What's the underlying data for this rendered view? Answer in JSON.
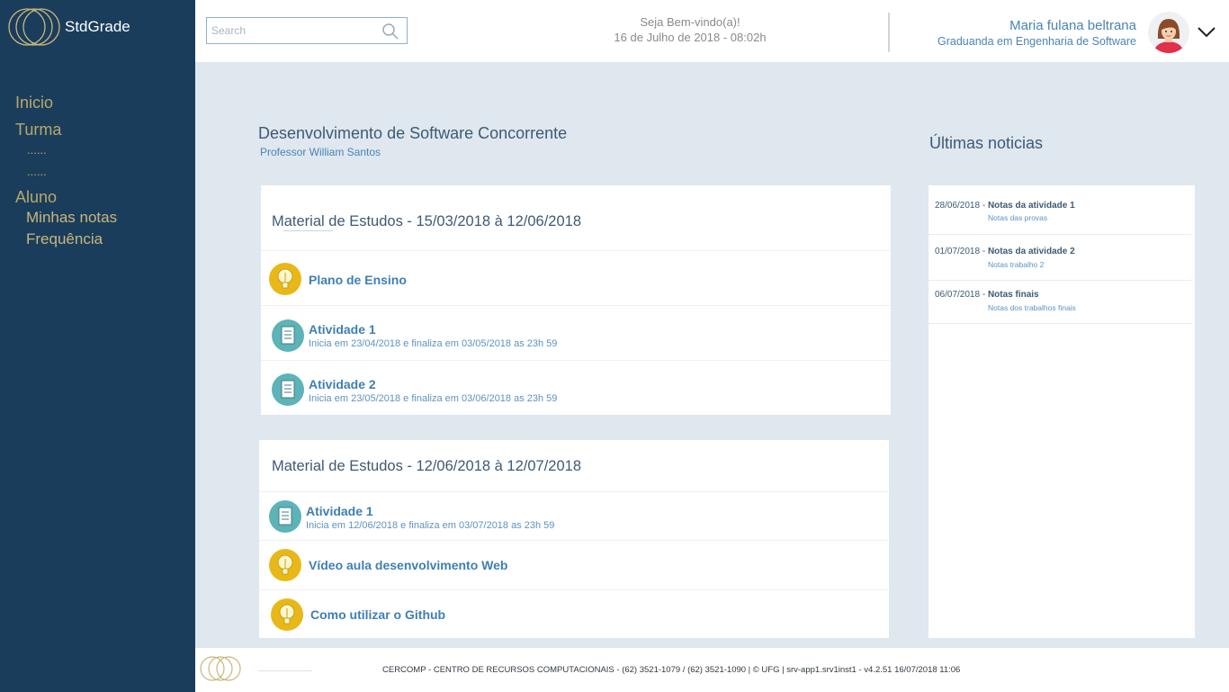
{
  "brand": {
    "name": "StdGrade"
  },
  "sidebar": {
    "inicio": "Inicio",
    "turma": "Turma",
    "turma_items": [
      "......",
      "......"
    ],
    "aluno": "Aluno",
    "aluno_items": [
      "Minhas notas",
      "Frequência"
    ]
  },
  "header": {
    "search_placeholder": "Search",
    "welcome": "Seja Bem-vindo(a)!",
    "date": "16 de Julho de 2018 - 08:02h",
    "user_name": "Maria fulana beltrana",
    "user_role": "Graduanda em Engenharia de Software"
  },
  "course": {
    "title": "Desenvolvimento de Software Concorrente",
    "professor": "Professor William Santos"
  },
  "cards": [
    {
      "title": "Material de Estudos - 15/03/2018 à 12/06/2018",
      "rows": [
        {
          "icon": "lightbulb-icon",
          "title": "Plano de Ensino",
          "sub": ""
        },
        {
          "icon": "document-icon",
          "title": "Atividade 1",
          "sub": "Inicia em 23/04/2018 e finaliza em 03/05/2018 as 23h 59"
        },
        {
          "icon": "document-icon",
          "title": "Atividade 2",
          "sub": "Inicia em 23/05/2018 e finaliza em 03/06/2018 as 23h 59"
        }
      ]
    },
    {
      "title": "Material de Estudos - 12/06/2018 à 12/07/2018",
      "rows": [
        {
          "icon": "document-icon",
          "title": "Atividade 1",
          "sub": "Inicia em 12/06/2018 e finaliza em 03/07/2018 as 23h 59"
        },
        {
          "icon": "lightbulb-icon",
          "title": "Vídeo aula desenvolvimento Web",
          "sub": ""
        },
        {
          "icon": "lightbulb-icon",
          "title": "Como utilizar o Github",
          "sub": ""
        }
      ]
    }
  ],
  "news": {
    "title": "Últimas noticias",
    "items": [
      {
        "date": "28/06/2018 - ",
        "title": "Notas da atividade 1",
        "sub": "Notas das provas"
      },
      {
        "date": "01/07/2018 - ",
        "title": "Notas da atividade 2",
        "sub": "Notas trabalho 2"
      },
      {
        "date": "06/07/2018 - ",
        "title": "Notas finais",
        "sub": "Notas dos trabalhos finais"
      }
    ]
  },
  "footer": {
    "text": "CERCOMP - CENTRO DE RECURSOS COMPUTACIONAIS - (62) 3521-1079 / (62) 3521-1090 | © UFG | srv-app1.srv1inst1 - v4.2.51 16/07/2018 11:06"
  },
  "colors": {
    "sidebar": "#1a3d5c",
    "accent_gold": "#b9a86a",
    "link_blue": "#3e7fb3",
    "bulb": "#e8b818",
    "doc": "#5db3b7"
  }
}
